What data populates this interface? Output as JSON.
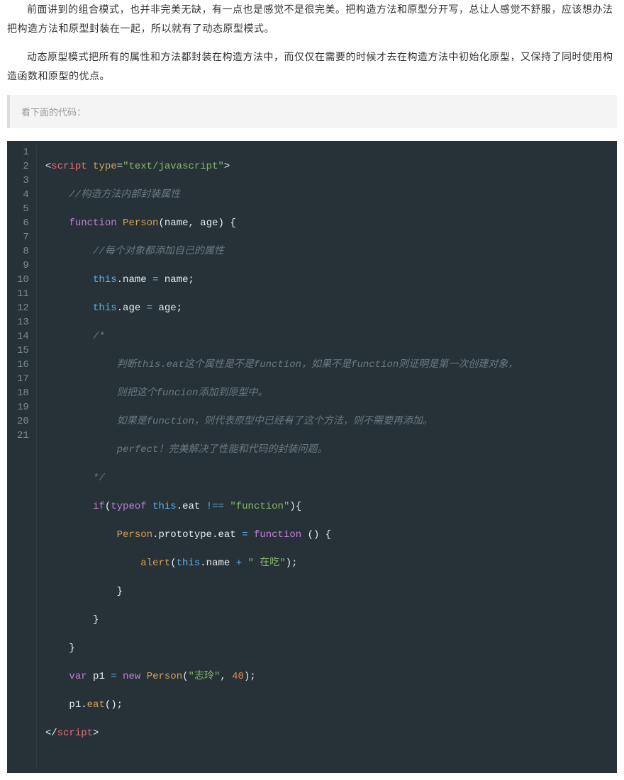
{
  "paragraphs": [
    "前面讲到的组合模式，也并非完美无缺，有一点也是感觉不是很完美。把构造方法和原型分开写，总让人感觉不舒服，应该想办法把构造方法和原型封装在一起，所以就有了动态原型模式。",
    "动态原型模式把所有的属性和方法都封装在构造方法中，而仅仅在需要的时候才去在构造方法中初始化原型，又保持了同时使用构造函数和原型的优点。"
  ],
  "note": "看下面的代码：",
  "code": {
    "total_lines": 21,
    "line1": {
      "open": "<",
      "tag": "script",
      "attr_sp": " ",
      "attr": "type",
      "eq": "=",
      "q1": "\"",
      "val": "text/javascript",
      "q2": "\"",
      "close": ">"
    },
    "line2": {
      "indent": "    ",
      "comment": "//构造方法内部封装属性"
    },
    "line3": {
      "indent": "    ",
      "kw": "function",
      "sp": " ",
      "name": "Person",
      "open": "(",
      "arg1": "name",
      "comma": ", ",
      "arg2": "age",
      "close": ")",
      "sp2": " ",
      "brace": "{"
    },
    "line4": {
      "indent": "        ",
      "comment": "//每个对象都添加自己的属性"
    },
    "line5": {
      "indent": "        ",
      "this": "this",
      "dot": ".",
      "prop": "name",
      "sp": " ",
      "eq": "=",
      "sp2": " ",
      "val": "name",
      "semi": ";"
    },
    "line6": {
      "indent": "        ",
      "this": "this",
      "dot": ".",
      "prop": "age",
      "sp": " ",
      "eq": "=",
      "sp2": " ",
      "val": "age",
      "semi": ";"
    },
    "line7": {
      "indent": "        ",
      "comment": "/*"
    },
    "line8": {
      "indent": "            ",
      "comment": "判断this.eat这个属性是不是function，如果不是function则证明是第一次创建对象，"
    },
    "line9": {
      "indent": "            ",
      "comment": "则把这个funcion添加到原型中。"
    },
    "line10": {
      "indent": "            ",
      "comment": "如果是function，则代表原型中已经有了这个方法，则不需要再添加。"
    },
    "line11": {
      "indent": "            ",
      "comment": "perfect！完美解决了性能和代码的封装问题。"
    },
    "line12": {
      "indent": "        ",
      "comment": "*/"
    },
    "line13": {
      "indent": "        ",
      "if": "if",
      "open": "(",
      "typeof": "typeof",
      "sp": " ",
      "this": "this",
      "dot": ".",
      "prop": "eat",
      "sp2": " ",
      "neq": "!==",
      "sp3": " ",
      "q1": "\"",
      "str": "function",
      "q2": "\"",
      "close": ")",
      "brace": "{"
    },
    "line14": {
      "indent": "            ",
      "cls": "Person",
      "dot1": ".",
      "proto": "prototype",
      "dot2": ".",
      "prop": "eat",
      "sp": " ",
      "eq": "=",
      "sp2": " ",
      "fn": "function",
      "sp3": " ",
      "paren": "()",
      "sp4": " ",
      "brace": "{"
    },
    "line15": {
      "indent": "                ",
      "alert": "alert",
      "open": "(",
      "this": "this",
      "dot": ".",
      "prop": "name",
      "sp": " ",
      "plus": "+",
      "sp2": " ",
      "q1": "\"",
      "str": " 在吃",
      "q2": "\"",
      "close": ")",
      "semi": ";"
    },
    "line16": {
      "indent": "            ",
      "brace": "}"
    },
    "line17": {
      "indent": "        ",
      "brace": "}"
    },
    "line18": {
      "indent": "    ",
      "brace": "}"
    },
    "line19": {
      "indent": "    ",
      "var": "var",
      "sp": " ",
      "v": "p1",
      "sp2": " ",
      "eq": "=",
      "sp3": " ",
      "new": "new",
      "sp4": " ",
      "cls": "Person",
      "open": "(",
      "q1": "\"",
      "str": "志玲",
      "q2": "\"",
      "comma": ", ",
      "num": "40",
      "close": ")",
      "semi": ";"
    },
    "line20": {
      "indent": "    ",
      "obj": "p1",
      "dot": ".",
      "method": "eat",
      "paren": "()",
      "semi": ";"
    },
    "line21": {
      "open": "</",
      "tag": "script",
      "close": ">"
    }
  }
}
